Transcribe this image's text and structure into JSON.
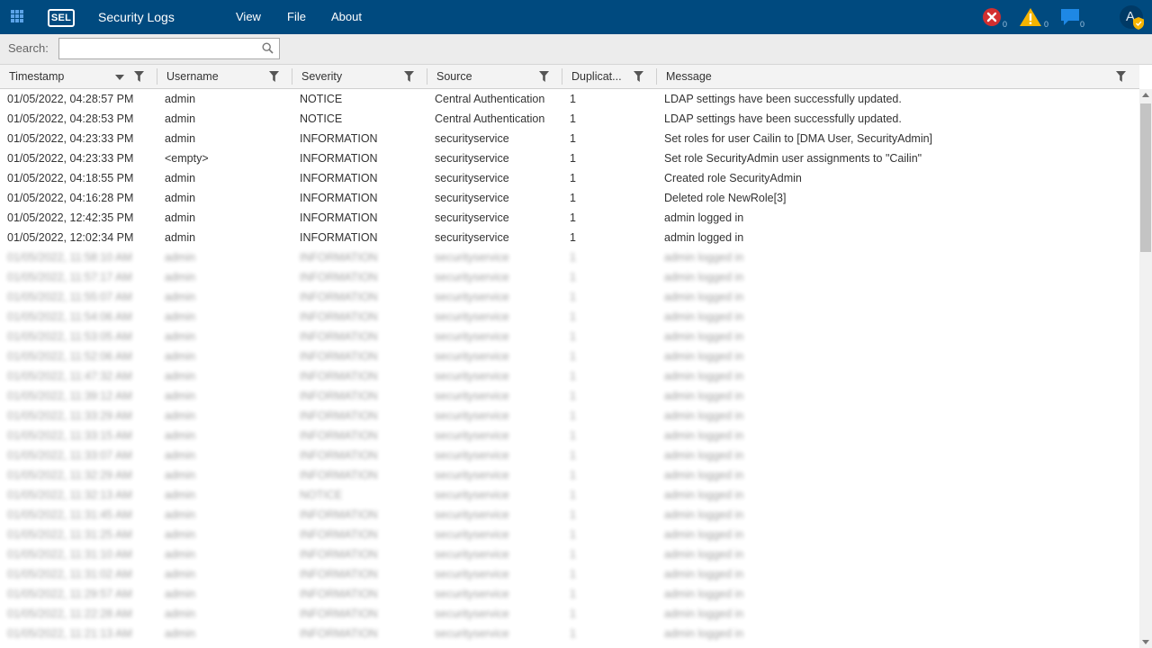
{
  "header": {
    "title": "Security Logs",
    "logo_text": "SEL",
    "menu": [
      "View",
      "File",
      "About"
    ],
    "status": {
      "errors": "0",
      "warnings": "0",
      "messages": "0"
    },
    "avatar_letter": "A",
    "colors": {
      "bar": "#004a7f",
      "error": "#d32f2f",
      "warning": "#f5b400",
      "message": "#1e88e5"
    }
  },
  "search": {
    "label": "Search:",
    "value": "",
    "placeholder": ""
  },
  "columns": [
    "Timestamp",
    "Username",
    "Severity",
    "Source",
    "Duplicat...",
    "Message"
  ],
  "rows": [
    [
      "01/05/2022, 04:28:57 PM",
      "admin",
      "NOTICE",
      "Central Authentication",
      "1",
      "LDAP settings have been successfully updated."
    ],
    [
      "01/05/2022, 04:28:53 PM",
      "admin",
      "NOTICE",
      "Central Authentication",
      "1",
      "LDAP settings have been successfully updated."
    ],
    [
      "01/05/2022, 04:23:33 PM",
      "admin",
      "INFORMATION",
      "securityservice",
      "1",
      "Set roles for user Cailin to [DMA User, SecurityAdmin]"
    ],
    [
      "01/05/2022, 04:23:33 PM",
      "<empty>",
      "INFORMATION",
      "securityservice",
      "1",
      "Set role SecurityAdmin user assignments to \"Cailin\""
    ],
    [
      "01/05/2022, 04:18:55 PM",
      "admin",
      "INFORMATION",
      "securityservice",
      "1",
      "Created role SecurityAdmin"
    ],
    [
      "01/05/2022, 04:16:28 PM",
      "admin",
      "INFORMATION",
      "securityservice",
      "1",
      "Deleted role NewRole[3]"
    ],
    [
      "01/05/2022, 12:42:35 PM",
      "admin",
      "INFORMATION",
      "securityservice",
      "1",
      "admin logged in"
    ],
    [
      "01/05/2022, 12:02:34 PM",
      "admin",
      "INFORMATION",
      "securityservice",
      "1",
      "admin logged in"
    ]
  ],
  "blurred_rows": [
    [
      "01/05/2022, 11:58:10 AM",
      "admin",
      "INFORMATION",
      "securityservice",
      "1",
      "admin logged in"
    ],
    [
      "01/05/2022, 11:57:17 AM",
      "admin",
      "INFORMATION",
      "securityservice",
      "1",
      "admin logged in"
    ],
    [
      "01/05/2022, 11:55:07 AM",
      "admin",
      "INFORMATION",
      "securityservice",
      "1",
      "admin logged in"
    ],
    [
      "01/05/2022, 11:54:06 AM",
      "admin",
      "INFORMATION",
      "securityservice",
      "1",
      "admin logged in"
    ],
    [
      "01/05/2022, 11:53:05 AM",
      "admin",
      "INFORMATION",
      "securityservice",
      "1",
      "admin logged in"
    ],
    [
      "01/05/2022, 11:52:06 AM",
      "admin",
      "INFORMATION",
      "securityservice",
      "1",
      "admin logged in"
    ],
    [
      "01/05/2022, 11:47:32 AM",
      "admin",
      "INFORMATION",
      "securityservice",
      "1",
      "admin logged in"
    ],
    [
      "01/05/2022, 11:39:12 AM",
      "admin",
      "INFORMATION",
      "securityservice",
      "1",
      "admin logged in"
    ],
    [
      "01/05/2022, 11:33:29 AM",
      "admin",
      "INFORMATION",
      "securityservice",
      "1",
      "admin logged in"
    ],
    [
      "01/05/2022, 11:33:15 AM",
      "admin",
      "INFORMATION",
      "securityservice",
      "1",
      "admin logged in"
    ],
    [
      "01/05/2022, 11:33:07 AM",
      "admin",
      "INFORMATION",
      "securityservice",
      "1",
      "admin logged in"
    ],
    [
      "01/05/2022, 11:32:29 AM",
      "admin",
      "INFORMATION",
      "securityservice",
      "1",
      "admin logged in"
    ],
    [
      "01/05/2022, 11:32:13 AM",
      "admin",
      "NOTICE",
      "securityservice",
      "1",
      "admin logged in"
    ],
    [
      "01/05/2022, 11:31:45 AM",
      "admin",
      "INFORMATION",
      "securityservice",
      "1",
      "admin logged in"
    ],
    [
      "01/05/2022, 11:31:25 AM",
      "admin",
      "INFORMATION",
      "securityservice",
      "1",
      "admin logged in"
    ],
    [
      "01/05/2022, 11:31:10 AM",
      "admin",
      "INFORMATION",
      "securityservice",
      "1",
      "admin logged in"
    ],
    [
      "01/05/2022, 11:31:02 AM",
      "admin",
      "INFORMATION",
      "securityservice",
      "1",
      "admin logged in"
    ],
    [
      "01/05/2022, 11:29:57 AM",
      "admin",
      "INFORMATION",
      "securityservice",
      "1",
      "admin logged in"
    ],
    [
      "01/05/2022, 11:22:28 AM",
      "admin",
      "INFORMATION",
      "securityservice",
      "1",
      "admin logged in"
    ],
    [
      "01/05/2022, 11:21:13 AM",
      "admin",
      "INFORMATION",
      "securityservice",
      "1",
      "admin logged in"
    ]
  ]
}
